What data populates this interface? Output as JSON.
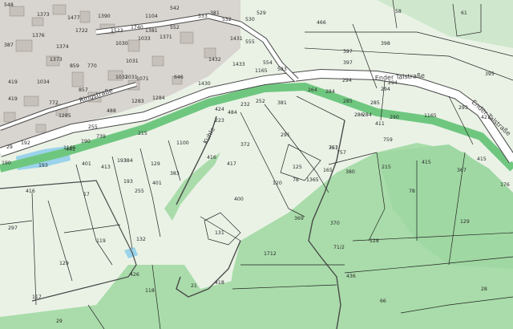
{
  "map": {
    "colors": {
      "meadow": "#eaf2e6",
      "forest": "#a9dcaa",
      "forest_dark": "#8fd09a",
      "settlement": "#d8d4cf",
      "building": "#c7c1bb",
      "water": "#9ad3ea",
      "road_fill": "#ffffff",
      "road_casing": "#4a4a4a",
      "parcel_line": "#222222",
      "green_band": "#6fc77f"
    },
    "streets": [
      {
        "name": "Ender Talstraße",
        "id": "ender-talstrasse-upper"
      },
      {
        "name": "Ender Talstraße",
        "id": "ender-talstrasse-east"
      },
      {
        "name": "Kuhle",
        "id": "kuhle"
      },
      {
        "name": "Ringstraße",
        "id": "ringstrasse"
      }
    ],
    "parcels": [
      "542",
      "529",
      "58",
      "61",
      "1373",
      "1477",
      "1390",
      "1104",
      "533",
      "381",
      "532",
      "530",
      "1376",
      "1523",
      "1740",
      "1381",
      "552",
      "1431",
      "466",
      "398",
      "387",
      "1374",
      "1722",
      "1030",
      "1033",
      "1371",
      "555",
      "1373",
      "859",
      "770",
      "1031",
      "1432",
      "1433",
      "548",
      "397",
      "397",
      "419",
      "1034",
      "1031",
      "1032",
      "646",
      "1165",
      "554",
      "583",
      "395",
      "857",
      "1071",
      "1430",
      "294",
      "284",
      "419",
      "1283",
      "1284",
      "294",
      "293",
      "772",
      "1285",
      "421",
      "232",
      "252",
      "381",
      "264",
      "285",
      "285",
      "286",
      "488",
      "424",
      "484",
      "223",
      "284",
      "294",
      "290",
      "411",
      "1165",
      "441",
      "215",
      "1100",
      "255",
      "372",
      "291",
      "759",
      "757",
      "751",
      "192",
      "1165",
      "739",
      "190",
      "193",
      "29",
      "401",
      "384",
      "129",
      "416",
      "417",
      "367",
      "215",
      "415",
      "415",
      "413",
      "383",
      "125",
      "78",
      "1365",
      "165",
      "380",
      "367",
      "190",
      "193",
      "416",
      "17",
      "193",
      "255",
      "78",
      "176",
      "401",
      "120",
      "129",
      "297",
      "400",
      "369",
      "370",
      "132",
      "131",
      "119",
      "129",
      "426",
      "21",
      "418",
      "1712",
      "128",
      "436",
      "71/2",
      "117",
      "118",
      "66",
      "28",
      "29"
    ]
  }
}
